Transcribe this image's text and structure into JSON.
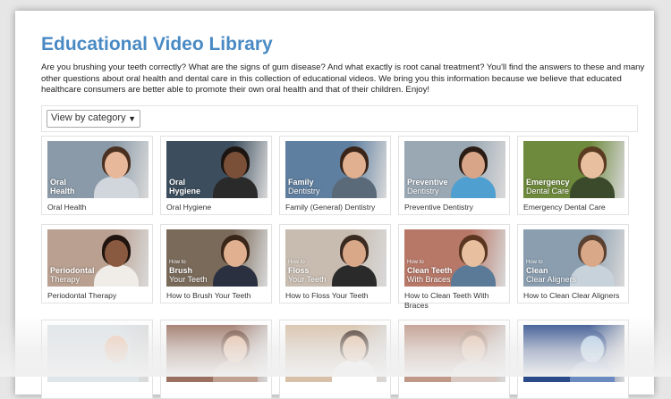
{
  "page": {
    "title": "Educational Video Library",
    "intro": "Are you brushing your teeth correctly? What are the signs of gum disease? And what exactly is root canal treatment? You'll find the answers to these and many other questions about oral health and dental care in this collection of educational videos. We bring you this information because we believe that educated healthcare consumers are better able to promote their own oral health and that of their children. Enjoy!"
  },
  "filter": {
    "label": "View by category",
    "arrow": "▼"
  },
  "videos": [
    {
      "caption": "Oral Health",
      "pre": "",
      "l1": "Oral",
      "l2": "Health",
      "bold": "l1l2",
      "bg": "#8a9aa8",
      "skin": "#e8b89a",
      "hair": "#4a3020",
      "shirt": "#d0d6dc"
    },
    {
      "caption": "Oral Hygiene",
      "pre": "",
      "l1": "Oral",
      "l2": "Hygiene",
      "bold": "l1l2",
      "bg": "#3c4e5e",
      "skin": "#7a5038",
      "hair": "#1c1410",
      "shirt": "#2a2a2a"
    },
    {
      "caption": "Family (General) Dentistry",
      "pre": "",
      "l1": "Family",
      "l2": "Dentistry",
      "bold": "l1",
      "bg": "#5f7fa0",
      "skin": "#e0b090",
      "hair": "#3a2418",
      "shirt": "#5a6a78"
    },
    {
      "caption": "Preventive Dentistry",
      "pre": "",
      "l1": "Preventive",
      "l2": "Dentistry",
      "bold": "l1",
      "bg": "#9aa8b4",
      "skin": "#d9a588",
      "hair": "#2a1c14",
      "shirt": "#4f9fd0"
    },
    {
      "caption": "Emergency Dental Care",
      "pre": "",
      "l1": "Emergency",
      "l2": "Dental Care",
      "bold": "l1",
      "bg": "#6e8a3c",
      "skin": "#e8c0a0",
      "hair": "#5a3a20",
      "shirt": "#3a4a2a"
    },
    {
      "caption": "Periodontal Therapy",
      "pre": "",
      "l1": "Periodontal",
      "l2": "Therapy",
      "bold": "l1",
      "bg": "#b9a090",
      "skin": "#8a5a40",
      "hair": "#20140e",
      "shirt": "#f0ece8"
    },
    {
      "caption": "How to Brush Your Teeth",
      "pre": "How to",
      "l1": "Brush",
      "l2": "Your Teeth",
      "bold": "l1",
      "bg": "#7a6a5a",
      "skin": "#e0b090",
      "hair": "#3a2618",
      "shirt": "#2a3040"
    },
    {
      "caption": "How to Floss Your Teeth",
      "pre": "How to",
      "l1": "Floss",
      "l2": "Your Teeth",
      "bold": "l1",
      "bg": "#c8bcb0",
      "skin": "#d8a888",
      "hair": "#3a2a20",
      "shirt": "#2a2a2a"
    },
    {
      "caption": "How to Clean Teeth With Braces",
      "pre": "How to",
      "l1": "Clean Teeth",
      "l2": "With Braces",
      "bold": "l1",
      "bg": "#b87868",
      "skin": "#e8c0a0",
      "hair": "#5a3620",
      "shirt": "#5a7a98"
    },
    {
      "caption": "How to Clean Clear Aligners",
      "pre": "How to",
      "l1": "Clean",
      "l2": "Clear Aligners",
      "bold": "l1",
      "bg": "#8a9eb0",
      "skin": "#d8a888",
      "hair": "#5a4030",
      "shirt": "#c8d2da"
    },
    {
      "caption": "",
      "pre": "",
      "l1": "",
      "l2": "",
      "bold": "l1",
      "bg": "#dfe6ea",
      "skin": "#f0c8b0",
      "hair": "#dfe6ea",
      "shirt": "#dfe6ea"
    },
    {
      "caption": "",
      "pre": "",
      "l1": "",
      "l2": "",
      "bold": "l1",
      "bg": "#9a7060",
      "skin": "#e8b898",
      "hair": "#6a4030",
      "shirt": "#c0a090"
    },
    {
      "caption": "",
      "pre": "",
      "l1": "",
      "l2": "",
      "bold": "l1",
      "bg": "#d8c0a8",
      "skin": "#e8c0a0",
      "hair": "#3a2418",
      "shirt": "#ffffff"
    },
    {
      "caption": "",
      "pre": "",
      "l1": "",
      "l2": "",
      "bold": "l1",
      "bg": "#c09888",
      "skin": "#e8c0a8",
      "hair": "#b09080",
      "shirt": "#d8c8c0"
    },
    {
      "caption": "",
      "pre": "",
      "l1": "",
      "l2": "",
      "bold": "l1",
      "bg": "#2a4a8a",
      "skin": "#a8c8e8",
      "hair": "#2a4a8a",
      "shirt": "#6a8ac0"
    }
  ]
}
